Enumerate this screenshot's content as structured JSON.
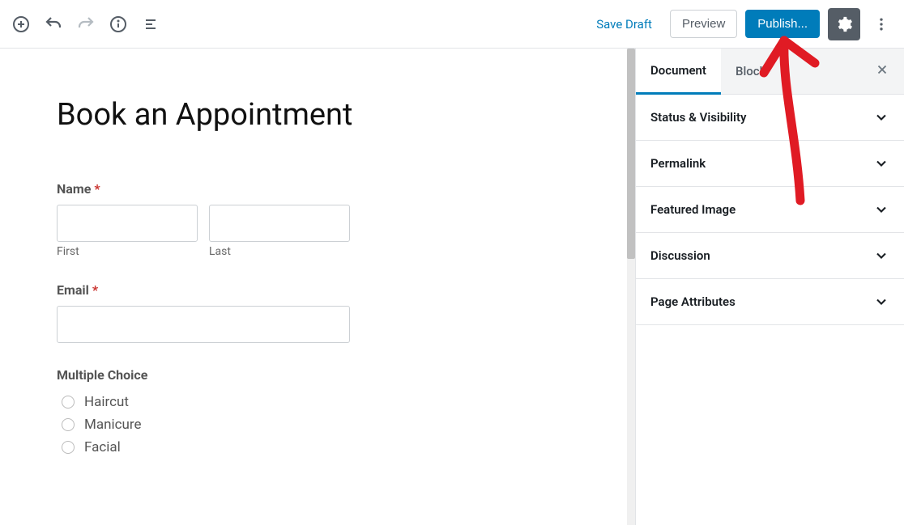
{
  "toolbar": {
    "save_draft_label": "Save Draft",
    "preview_label": "Preview",
    "publish_label": "Publish..."
  },
  "editor": {
    "title": "Book an Appointment",
    "form": {
      "name_label": "Name",
      "first_sublabel": "First",
      "last_sublabel": "Last",
      "email_label": "Email",
      "multiple_choice_label": "Multiple Choice",
      "choices": [
        "Haircut",
        "Manicure",
        "Facial"
      ]
    }
  },
  "sidebar": {
    "tabs": {
      "document": "Document",
      "block": "Block"
    },
    "panels": [
      "Status & Visibility",
      "Permalink",
      "Featured Image",
      "Discussion",
      "Page Attributes"
    ]
  }
}
